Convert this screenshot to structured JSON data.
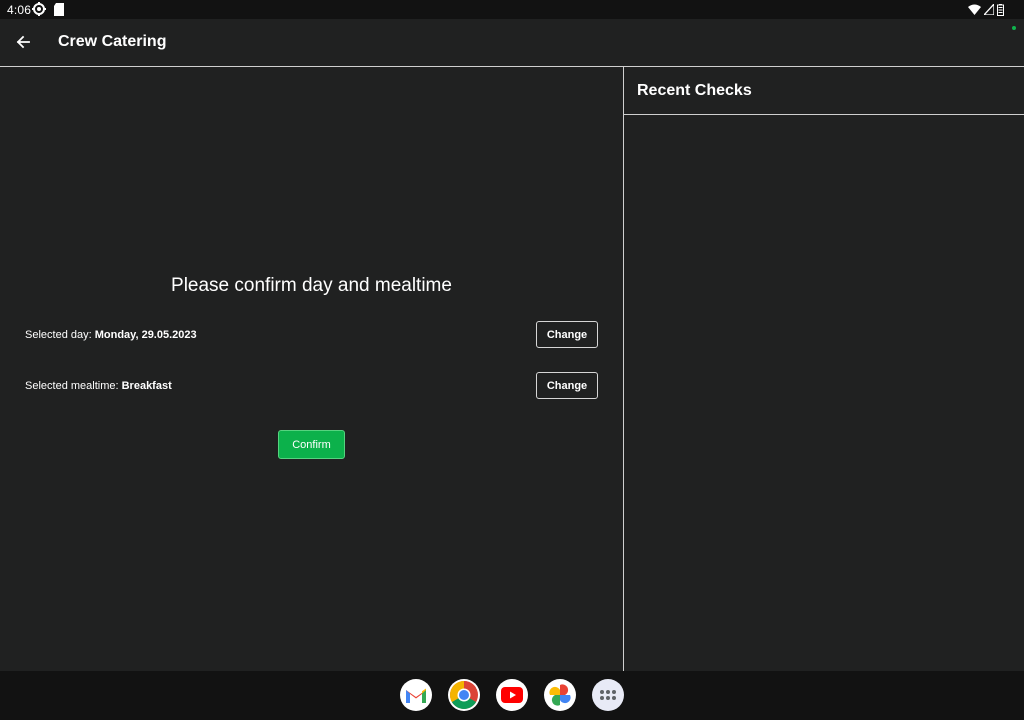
{
  "status_bar": {
    "time": "4:06"
  },
  "app_bar": {
    "title": "Crew Catering"
  },
  "main": {
    "prompt": "Please confirm day and mealtime",
    "day": {
      "label": "Selected day: ",
      "value": "Monday, 29.05.2023",
      "change_label": "Change"
    },
    "mealtime": {
      "label": "Selected mealtime: ",
      "value": "Breakfast",
      "change_label": "Change"
    },
    "confirm_label": "Confirm"
  },
  "side": {
    "title": "Recent Checks",
    "checks": []
  },
  "dock": {
    "apps": [
      "gmail-icon",
      "chrome-icon",
      "youtube-icon",
      "photos-icon",
      "app-drawer-icon"
    ]
  },
  "colors": {
    "background": "#202121",
    "bars": "#121212",
    "accent_green": "#0cb14b",
    "divider": "#cfcfcf"
  }
}
